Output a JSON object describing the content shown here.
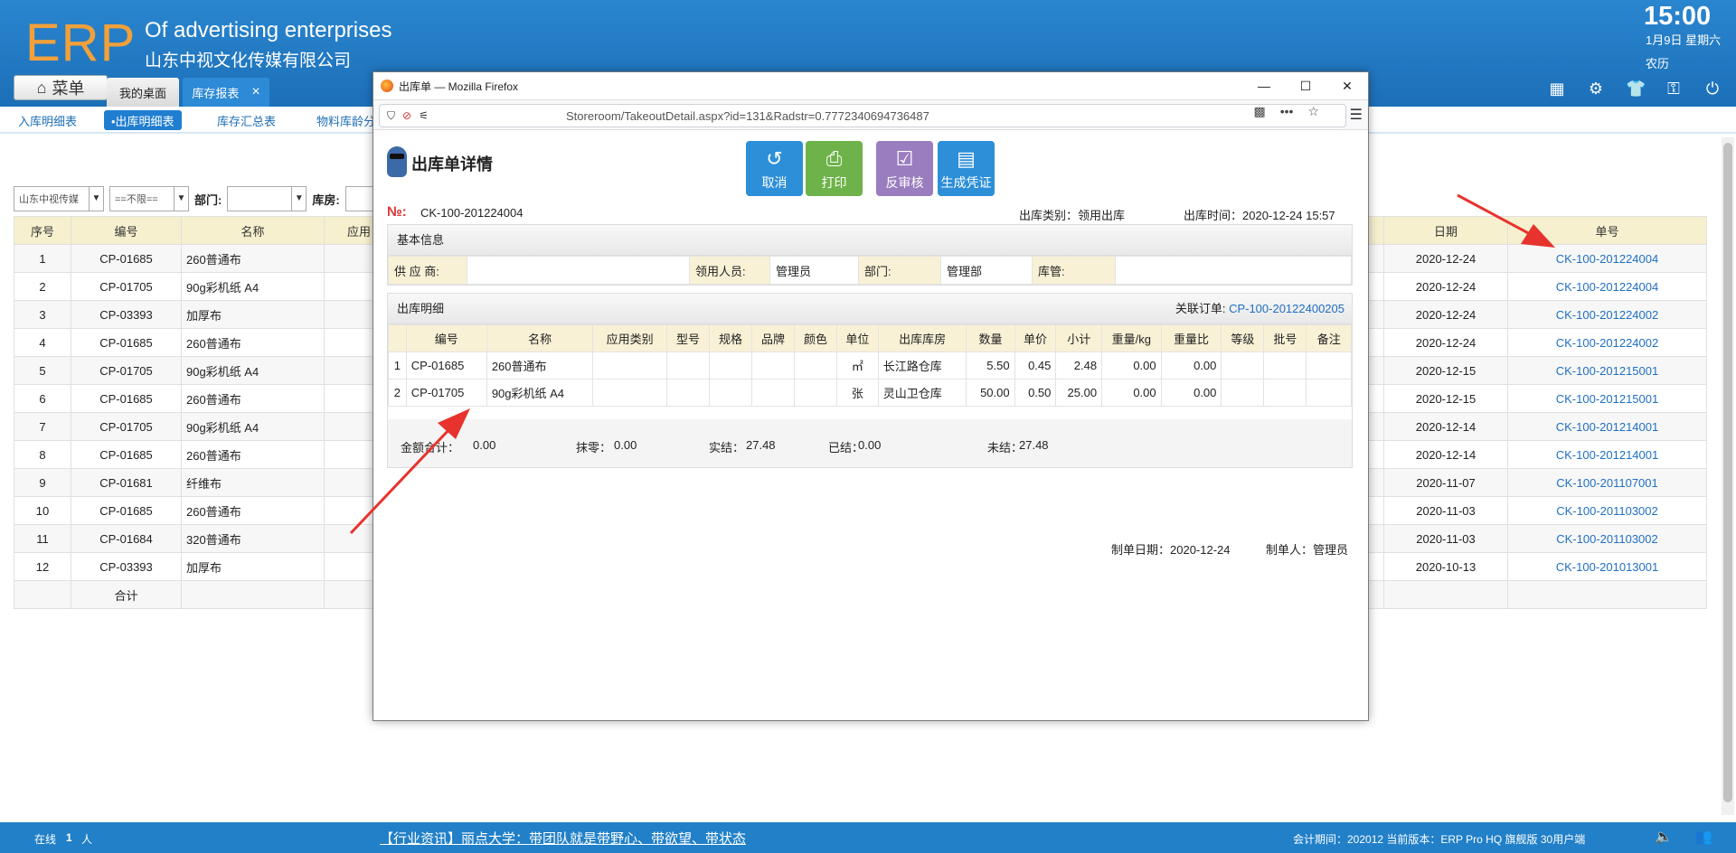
{
  "header": {
    "logo": "ERP",
    "company_en": "Of advertising enterprises",
    "company_cn": "山东中视文化传媒有限公司",
    "time": "15:00",
    "date": "1月9日 星期六",
    "lunar": "农历",
    "menu_label": "菜单"
  },
  "tabs": [
    {
      "label": "我的桌面"
    },
    {
      "label": "库存报表",
      "close": "×"
    }
  ],
  "subnav": [
    "入库明细表",
    "•出库明细表",
    "库存汇总表",
    "物料库龄分"
  ],
  "filters": {
    "company": "山东中视传媒",
    "limit": "==不限==",
    "dept_label": "部门:",
    "dept_value": "",
    "store_label": "库房:"
  },
  "table": {
    "headers": [
      "序号",
      "编号",
      "名称",
      "应用",
      "日期",
      "单号"
    ],
    "rows": [
      [
        "1",
        "CP-01685",
        "260普通布",
        "2020-12-24",
        "CK-100-201224004"
      ],
      [
        "2",
        "CP-01705",
        "90g彩机纸 A4",
        "2020-12-24",
        "CK-100-201224004"
      ],
      [
        "3",
        "CP-03393",
        "加厚布",
        "2020-12-24",
        "CK-100-201224002"
      ],
      [
        "4",
        "CP-01685",
        "260普通布",
        "2020-12-24",
        "CK-100-201224002"
      ],
      [
        "5",
        "CP-01705",
        "90g彩机纸 A4",
        "2020-12-15",
        "CK-100-201215001"
      ],
      [
        "6",
        "CP-01685",
        "260普通布",
        "2020-12-15",
        "CK-100-201215001"
      ],
      [
        "7",
        "CP-01705",
        "90g彩机纸 A4",
        "2020-12-14",
        "CK-100-201214001"
      ],
      [
        "8",
        "CP-01685",
        "260普通布",
        "2020-12-14",
        "CK-100-201214001"
      ],
      [
        "9",
        "CP-01681",
        "纤维布",
        "2020-11-07",
        "CK-100-201107001"
      ],
      [
        "10",
        "CP-01685",
        "260普通布",
        "2020-11-03",
        "CK-100-201103002"
      ],
      [
        "11",
        "CP-01684",
        "320普通布",
        "2020-11-03",
        "CK-100-201103002"
      ],
      [
        "12",
        "CP-03393",
        "加厚布",
        "2020-10-13",
        "CK-100-201013001"
      ]
    ],
    "sum_label": "合计"
  },
  "popup": {
    "window_title": "出库单 — Mozilla Firefox",
    "url": "Storeroom/TakeoutDetail.aspx?id=131&Radstr=0.7772340694736487",
    "heading": "出库单详情",
    "buttons": {
      "cancel": "取消",
      "print": "打印",
      "unreview": "反审核",
      "voucher": "生成凭证"
    },
    "no_label": "№:",
    "no_value": "CK-100-201224004",
    "type_text": "出库类别：领用出库",
    "time_text": "出库时间：2020-12-24 15:57",
    "basic": {
      "title": "基本信息",
      "supplier_label": "供 应 商:",
      "supplier": "",
      "receiver_label": "领用人员:",
      "receiver": "管理员",
      "dept_label": "部门:",
      "dept": "管理部",
      "keeper_label": "库管:",
      "keeper": ""
    },
    "detail": {
      "title": "出库明细",
      "order_label": "关联订单:",
      "order": "CP-100-20122400205",
      "headers": [
        "",
        "编号",
        "名称",
        "应用类别",
        "型号",
        "规格",
        "品牌",
        "颜色",
        "单位",
        "出库库房",
        "数量",
        "单价",
        "小计",
        "重量/kg",
        "重量比",
        "等级",
        "批号",
        "备注"
      ],
      "rows": [
        [
          "1",
          "CP-01685",
          "260普通布",
          "",
          "",
          "",
          "",
          "",
          "㎡",
          "长江路仓库",
          "5.50",
          "0.45",
          "2.48",
          "0.00",
          "0.00",
          "",
          "",
          ""
        ],
        [
          "2",
          "CP-01705",
          "90g彩机纸 A4",
          "",
          "",
          "",
          "",
          "",
          "张",
          "灵山卫仓库",
          "50.00",
          "0.50",
          "25.00",
          "0.00",
          "0.00",
          "",
          "",
          ""
        ]
      ]
    },
    "totals": {
      "amount_label": "金额合计：",
      "amount": "0.00",
      "discount_label": "抹零：",
      "discount": "0.00",
      "actual_label": "实结：",
      "actual": "27.48",
      "settled_label": "已结：",
      "settled": "0.00",
      "unsettled_label": "未结：",
      "unsettled": "27.48"
    },
    "footer": {
      "date": "制单日期：2020-12-24",
      "maker": "制单人：管理员"
    }
  },
  "status": {
    "online": "在线",
    "online_count": "1",
    "online_unit": "人",
    "news": "【行业资讯】丽点大学：带团队就是带野心、带欲望、带状态",
    "info": "会计期间：202012 当前版本：ERP Pro HQ 旗舰版 30用户端"
  }
}
